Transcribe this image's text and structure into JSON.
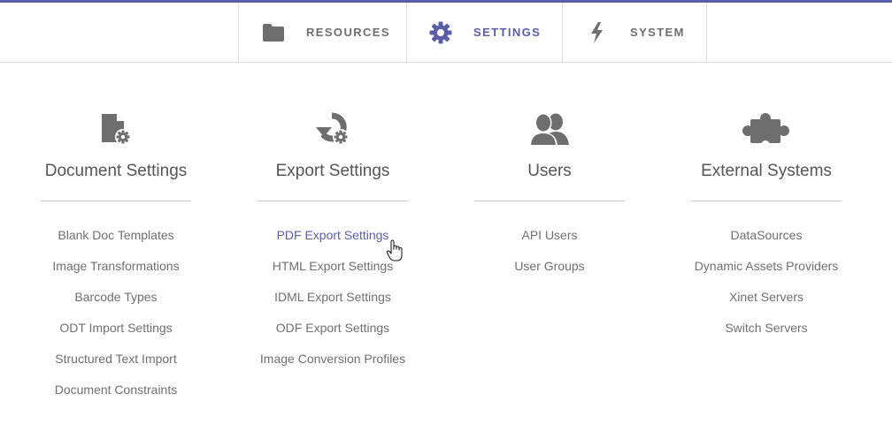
{
  "colors": {
    "accent": "#5b5ea6",
    "text": "#6f6f6f",
    "heading": "#555555",
    "icon": "#6e6e6e",
    "border": "#dedede"
  },
  "nav": {
    "tabs": [
      {
        "label": "RESOURCES",
        "icon": "folder-icon",
        "active": false
      },
      {
        "label": "SETTINGS",
        "icon": "gear-icon",
        "active": true
      },
      {
        "label": "SYSTEM",
        "icon": "lightning-icon",
        "active": false
      }
    ]
  },
  "sections": [
    {
      "title": "Document Settings",
      "icon": "document-settings-icon",
      "links": [
        "Blank Doc Templates",
        "Image Transformations",
        "Barcode Types",
        "ODT Import Settings",
        "Structured Text Import",
        "Document Constraints"
      ]
    },
    {
      "title": "Export Settings",
      "icon": "export-settings-icon",
      "links": [
        "PDF Export Settings",
        "HTML Export Settings",
        "IDML Export Settings",
        "ODF Export Settings",
        "Image Conversion Profiles"
      ]
    },
    {
      "title": "Users",
      "icon": "users-icon",
      "links": [
        "API Users",
        "User Groups"
      ]
    },
    {
      "title": "External Systems",
      "icon": "puzzle-piece-icon",
      "links": [
        "DataSources",
        "Dynamic Assets Providers",
        "Xinet Servers",
        "Switch Servers"
      ]
    }
  ],
  "hovered_link": "PDF Export Settings"
}
